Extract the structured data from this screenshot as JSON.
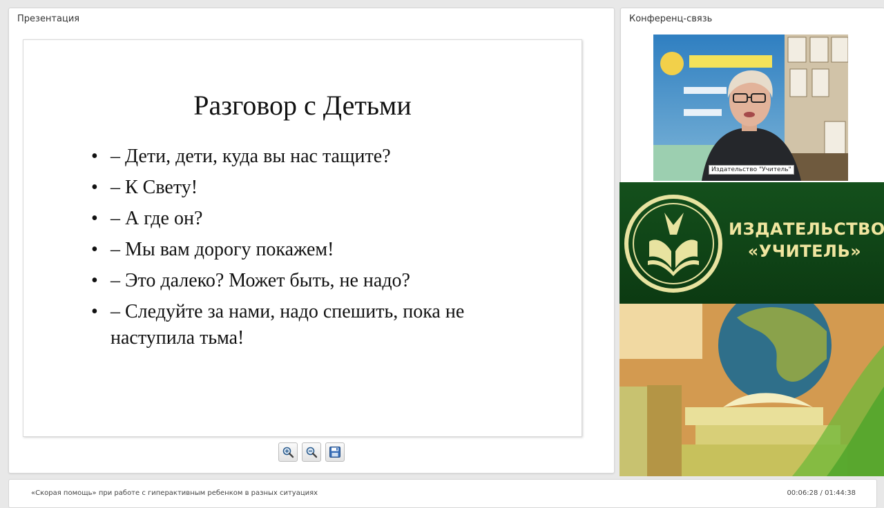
{
  "presentation": {
    "panel_title": "Презентация",
    "slide": {
      "title": "Разговор с Детьми",
      "bullets": [
        "– Дети, дети, куда вы нас тащите?",
        "– К Свету!",
        "– А где он?",
        "– Мы вам дорогу покажем!",
        "– Это далеко? Может быть, не надо?",
        "– Следуйте за нами, надо спешить, пока не наступила тьма!"
      ]
    },
    "toolbar": {
      "zoom_in_icon": "zoom-in-icon",
      "zoom_out_icon": "zoom-out-icon",
      "save_icon": "save-icon"
    }
  },
  "conference": {
    "panel_title": "Конференц-связь",
    "video_label": "Издательство \"Учитель\"",
    "banner_name_line1": "ИЗДАТЕЛЬСТВО",
    "banner_name_line2": "«УЧИТЕЛЬ»"
  },
  "footer": {
    "title": "«Скорая помощь» при работе с гиперактивным ребенком в разных ситуациях",
    "time": "00:06:28 / 01:44:38"
  },
  "colors": {
    "banner_green": "#14501c",
    "banner_gold": "#e8e3a0",
    "background": "#e8e8e8"
  }
}
